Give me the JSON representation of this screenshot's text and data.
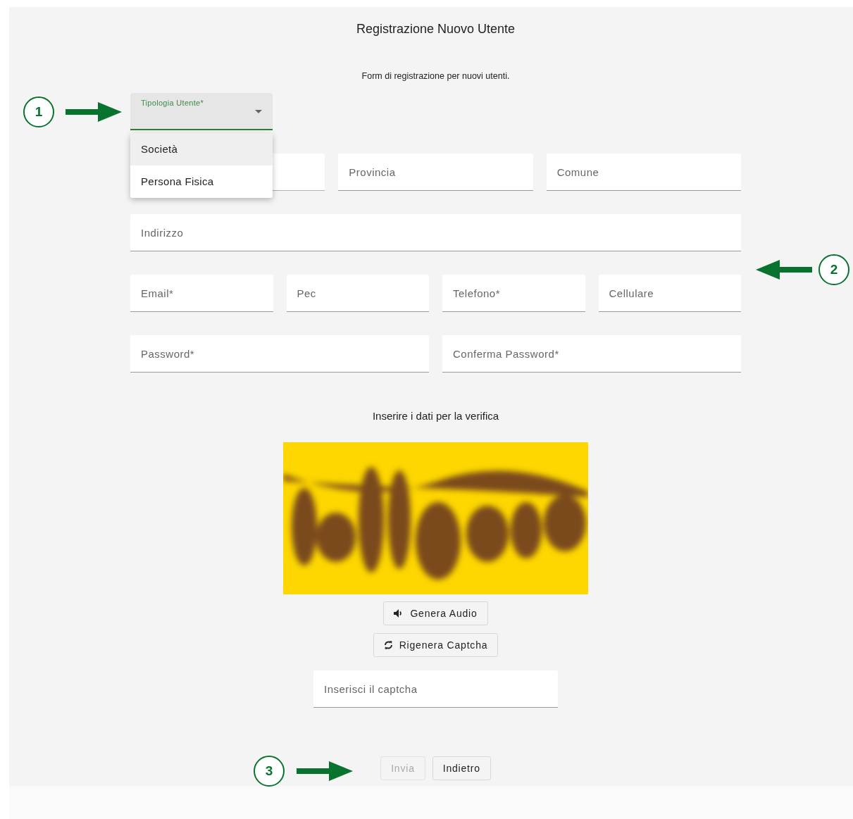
{
  "title": "Registrazione Nuovo Utente",
  "subtitle": "Form di registrazione per nuovi utenti.",
  "select": {
    "label": "Tipologia Utente*",
    "expanded": true,
    "options": [
      {
        "label": "Società",
        "selected": true
      },
      {
        "label": "Persona Fisica",
        "selected": false
      }
    ]
  },
  "rows": [
    {
      "fields": [
        {
          "covered": true
        },
        {
          "label": "Provincia",
          "covered": false
        },
        {
          "label": "Comune",
          "covered": false
        }
      ]
    },
    {
      "fields": [
        {
          "label": "Indirizzo"
        }
      ]
    },
    {
      "fields": [
        {
          "label": "Email*"
        },
        {
          "label": "Pec"
        },
        {
          "label": "Telefono*"
        },
        {
          "label": "Cellulare"
        }
      ]
    },
    {
      "fields": [
        {
          "label": "Password*"
        },
        {
          "label": "Conferma Password*"
        }
      ]
    }
  ],
  "verify_heading": "Inserire i dati per la verifica",
  "captcha_buttons": [
    {
      "kind": "audio",
      "label": "Genera Audio"
    },
    {
      "kind": "refresh",
      "label": "Rigenera Captcha"
    }
  ],
  "captcha_input": {
    "placeholder": "Inserisci il captcha"
  },
  "actions": [
    {
      "label": "Invia",
      "disabled": true
    },
    {
      "label": "Indietro",
      "disabled": false
    }
  ],
  "callouts": [
    {
      "number": "1",
      "points_left": false
    },
    {
      "number": "2",
      "points_left": true
    },
    {
      "number": "3",
      "points_left": false
    }
  ]
}
